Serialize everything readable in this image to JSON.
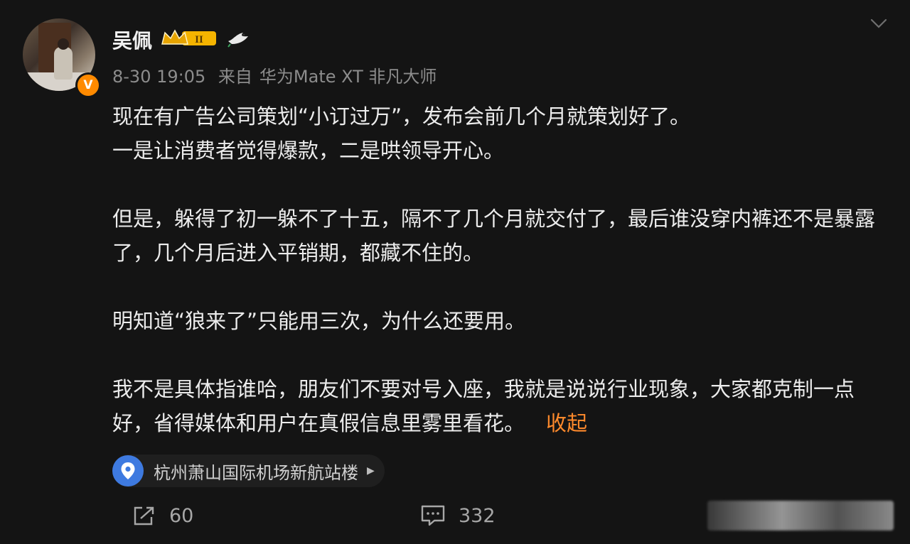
{
  "post": {
    "username": "吴佩",
    "level_badge": "II",
    "timestamp": "8-30 19:05",
    "source_prefix": "来自",
    "source_device": "华为Mate XT 非凡大师",
    "paragraphs": [
      "现在有广告公司策划“小订过万”，发布会前几个月就策划好了。",
      "一是让消费者觉得爆款，二是哄领导开心。",
      "",
      "但是，躲得了初一躲不了十五，隔不了几个月就交付了，最后谁没穿内裤还不是暴露了，几个月后进入平销期，都藏不住的。",
      "",
      "明知道“狼来了”只能用三次，为什么还要用。",
      "",
      "我不是具体指谁哈，朋友们不要对号入座，我就是说说行业现象，大家都克制一点好，省得媒体和用户在真假信息里雾里看花。"
    ],
    "collapse_label": "收起",
    "location": "杭州萧山国际机场新航站楼",
    "repost_count": "60",
    "comment_count": "332",
    "accent_color": "#ff8a2c",
    "verify_badge": "V"
  }
}
